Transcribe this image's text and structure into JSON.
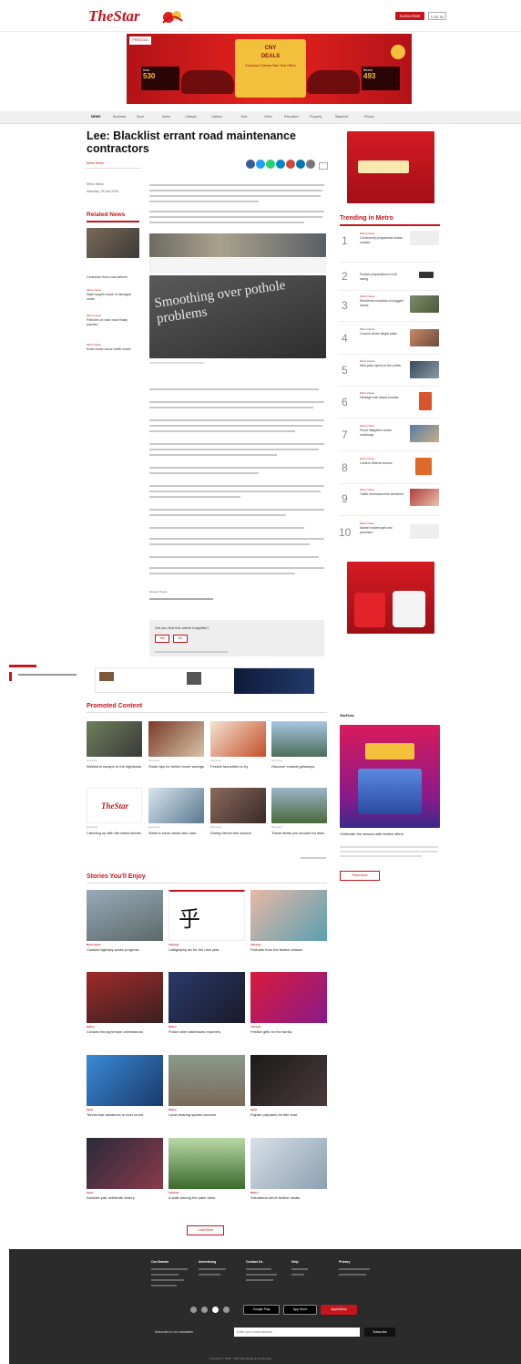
{
  "header": {
    "logo": "TheStar",
    "subscribe": "SUBSCRIBE",
    "login": "LOG IN"
  },
  "banner": {
    "brand": "PERODUA",
    "headline_1": "CNY",
    "headline_2": "DEALS",
    "promo_note": "Exclusive Chinese New Year Offers",
    "left_model": "Axia",
    "left_price": "530",
    "right_model": "Bezza",
    "right_price": "493"
  },
  "nav": [
    "NEWS",
    "Business",
    "Sport",
    "Metro",
    "Lifestyle",
    "Opinion",
    "Tech",
    "Video",
    "Education",
    "Property",
    "Starpicks",
    "Photos"
  ],
  "article": {
    "title": "Lee: Blacklist errant road maintenance contractors",
    "byline": "Metro News",
    "meta_label": "Metro News",
    "meta_date": "Saturday, 25 Jan 2025",
    "image_caption": "Smoothing over pothole problems",
    "tags_label": "Related Topics",
    "poll_question": "Did you find this article insightful?",
    "poll_yes": "Yes",
    "poll_no": "No"
  },
  "related": {
    "heading": "Related News",
    "items": [
      {
        "cat": "Metro News",
        "title": "Contractor fixes road defects"
      },
      {
        "cat": "Metro News",
        "title": "State targets repair of damaged roads"
      },
      {
        "cat": "Metro News",
        "title": "Potholes on main road finally patched"
      },
      {
        "cat": "Metro News",
        "title": "Road works cause traffic snarls"
      }
    ]
  },
  "trending": {
    "heading": "Trending in Metro",
    "items": [
      {
        "n": "1",
        "cat": "Metro News",
        "title": "Community programme draws crowds"
      },
      {
        "n": "2",
        "cat": "Metro News",
        "title": "Festive preparations in full swing"
      },
      {
        "n": "3",
        "cat": "Metro News",
        "title": "Residents complain of clogged drains"
      },
      {
        "n": "4",
        "cat": "Metro News",
        "title": "Council clears illegal stalls"
      },
      {
        "n": "5",
        "cat": "Metro News",
        "title": "New park opens to the public"
      },
      {
        "n": "6",
        "cat": "Metro News",
        "title": "Heritage trail draws tourists"
      },
      {
        "n": "7",
        "cat": "Metro News",
        "title": "Flood mitigation works underway"
      },
      {
        "n": "8",
        "cat": "Metro News",
        "title": "Lantern festival returns"
      },
      {
        "n": "9",
        "cat": "Metro News",
        "title": "Traffic diversions this weekend"
      },
      {
        "n": "10",
        "cat": "Metro News",
        "title": "Market traders get new premises"
      }
    ]
  },
  "promoted": {
    "heading": "Promoted Content",
    "items": [
      {
        "cat": "Sponsored",
        "title": "Weekend escape to the highlands"
      },
      {
        "cat": "Sponsored",
        "title": "Smart tips for better home savings"
      },
      {
        "cat": "Sponsored",
        "title": "Festive favourites to try"
      },
      {
        "cat": "Sponsored",
        "title": "Discover coastal getaways"
      },
      {
        "cat": "Sponsored",
        "title": "Catching up with the latest stories"
      },
      {
        "cat": "Sponsored",
        "title": "What to know about skin care"
      },
      {
        "cat": "Sponsored",
        "title": "Dining trends this season"
      },
      {
        "cat": "Sponsored",
        "title": "Travel deals you should not miss"
      }
    ]
  },
  "sidebar_ad": {
    "label": "StarPicks",
    "title": "Celebrate the season with festive offers",
    "button": "Read More"
  },
  "stories": {
    "heading": "Stories You'll Enjoy",
    "items": [
      {
        "cat": "Metro News",
        "title": "Coastal highway works progress"
      },
      {
        "cat": "Lifestyle",
        "title": "Calligraphy art for the new year"
      },
      {
        "cat": "Lifestyle",
        "title": "Portraits from the festive season"
      },
      {
        "cat": "Nation",
        "title": "Crowds throng temple celebrations"
      },
      {
        "cat": "Nation",
        "title": "Police chief addresses reporters"
      },
      {
        "cat": "Lifestyle",
        "title": "Festive gifts for the family"
      },
      {
        "cat": "Sport",
        "title": "Tennis star advances to next round"
      },
      {
        "cat": "Nation",
        "title": "Land clearing sparks concern"
      },
      {
        "cat": "Sport",
        "title": "Fighter prepares for title bout"
      },
      {
        "cat": "Sport",
        "title": "Doubles pair celebrate victory"
      },
      {
        "cat": "Lifestyle",
        "title": "A walk among the palm trees"
      },
      {
        "cat": "Nation",
        "title": "Volunteers serve festive meals"
      }
    ],
    "load_more": "Load More"
  },
  "footer": {
    "cols": [
      "Our Brands",
      "Advertising",
      "Contact Us",
      "Help",
      "Privacy"
    ],
    "newsletter_label": "Subscribe to our newsletter",
    "newsletter_placeholder": "Enter your email address",
    "newsletter_button": "Subscribe",
    "stores": [
      "Google Play",
      "App Store",
      "AppGallery"
    ],
    "copyright": "Copyright © 1995 - 2025 Star Media Group Berhad"
  },
  "colors": {
    "brand_red": "#c4161c",
    "footer_bg": "#2b2b2b"
  }
}
